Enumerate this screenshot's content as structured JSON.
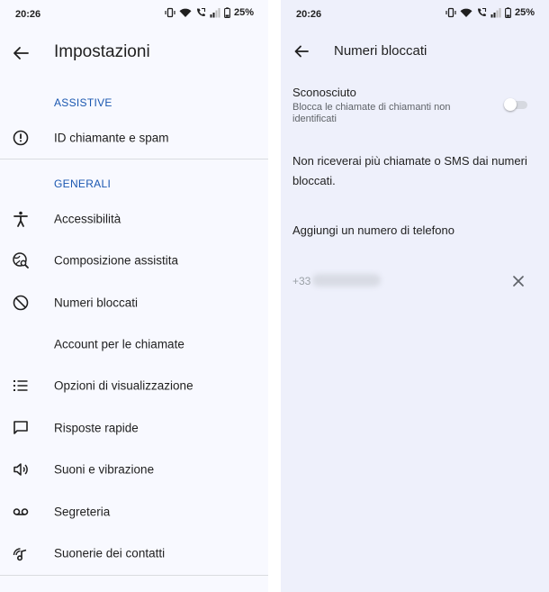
{
  "left": {
    "status": {
      "time": "20:26",
      "battery": "25%"
    },
    "title": "Impostazioni",
    "sections": [
      {
        "header": "ASSISTIVE",
        "items": [
          {
            "label": "ID chiamante e spam",
            "icon": "alert-circle-icon"
          }
        ]
      },
      {
        "header": "GENERALI",
        "items": [
          {
            "label": "Accessibilità",
            "icon": "accessibility-icon"
          },
          {
            "label": "Composizione assistita",
            "icon": "globe-search-icon"
          },
          {
            "label": "Numeri bloccati",
            "icon": "block-icon"
          },
          {
            "label": "Account per le chiamate",
            "icon": ""
          },
          {
            "label": "Opzioni di visualizzazione",
            "icon": "list-icon"
          },
          {
            "label": "Risposte rapide",
            "icon": "message-icon"
          },
          {
            "label": "Suoni e vibrazione",
            "icon": "speaker-icon"
          },
          {
            "label": "Segreteria",
            "icon": "voicemail-icon"
          },
          {
            "label": "Suonerie dei contatti",
            "icon": "ringtone-icon"
          }
        ]
      }
    ]
  },
  "right": {
    "status": {
      "time": "20:26",
      "battery": "25%"
    },
    "title": "Numeri bloccati",
    "unknown": {
      "title": "Sconosciuto",
      "subtitle": "Blocca le chiamate di chiamanti non identificati",
      "enabled": false
    },
    "info": "Non riceverai più chiamate o SMS dai numeri bloccati.",
    "add_number": "Aggiungi un numero di telefono",
    "blocked": [
      {
        "prefix": "+33"
      }
    ]
  }
}
